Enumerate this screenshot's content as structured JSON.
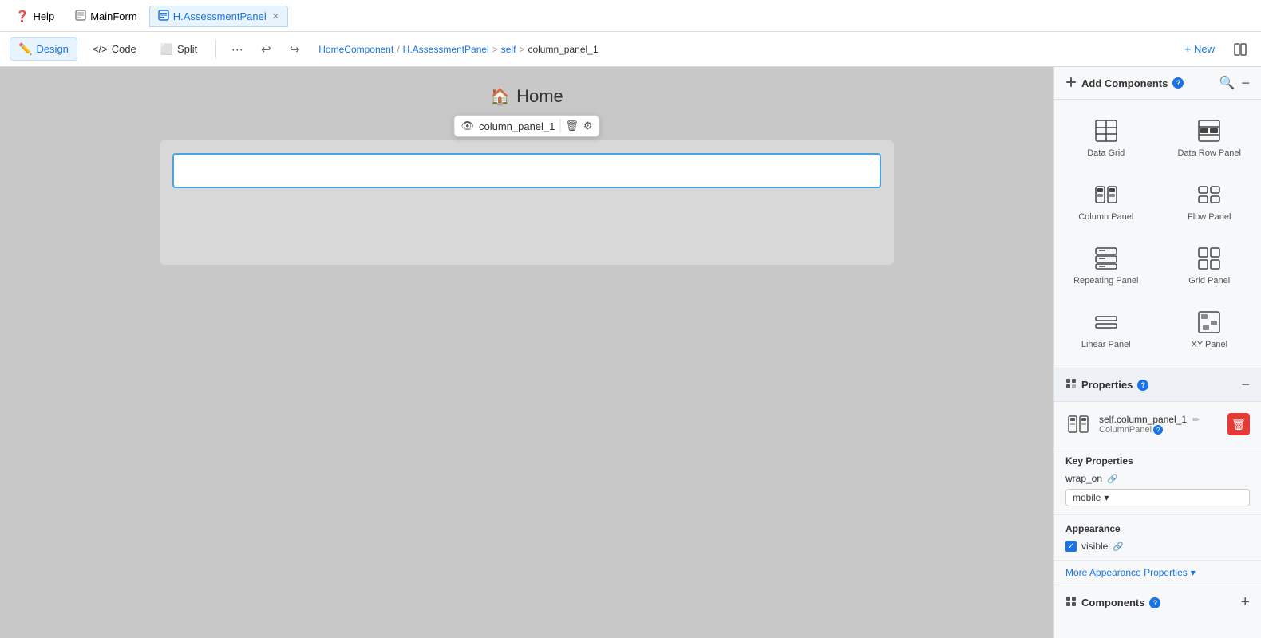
{
  "tabs": [
    {
      "id": "help",
      "label": "Help",
      "icon": "help",
      "active": false,
      "closable": false
    },
    {
      "id": "mainform",
      "label": "MainForm",
      "icon": "form",
      "active": false,
      "closable": false
    },
    {
      "id": "assessment",
      "label": "H.AssessmentPanel",
      "icon": "panel",
      "active": true,
      "closable": true
    }
  ],
  "toolbar": {
    "design_label": "Design",
    "code_label": "Code",
    "split_label": "Split",
    "new_label": "+ New"
  },
  "breadcrumb": {
    "parts": [
      "HomeComponent",
      "/",
      "H.AssessmentPanel",
      ">",
      "self",
      ">",
      "column_panel_1"
    ]
  },
  "canvas": {
    "title": "Home",
    "panel_name": "column_panel_1"
  },
  "add_components": {
    "title": "Add Components",
    "info": "?",
    "items": [
      {
        "id": "data-grid",
        "label": "Data Grid"
      },
      {
        "id": "data-row-panel",
        "label": "Data Row Panel"
      },
      {
        "id": "column-panel",
        "label": "Column Panel"
      },
      {
        "id": "flow-panel",
        "label": "Flow Panel"
      },
      {
        "id": "repeating-panel",
        "label": "Repeating Panel"
      },
      {
        "id": "grid-panel",
        "label": "Grid Panel"
      },
      {
        "id": "linear-panel",
        "label": "Linear Panel"
      },
      {
        "id": "xya-panel",
        "label": "XY Panel"
      }
    ]
  },
  "properties": {
    "title": "Properties",
    "info": "?",
    "component_name": "self.column_panel_1",
    "component_type": "ColumnPanel",
    "key_properties_title": "Key Properties",
    "wrap_on_label": "wrap_on",
    "wrap_on_value": "mobile",
    "appearance_title": "Appearance",
    "visible_label": "visible",
    "more_props_label": "More Appearance Properties"
  },
  "components_bottom": {
    "title": "Components",
    "info": "?"
  }
}
